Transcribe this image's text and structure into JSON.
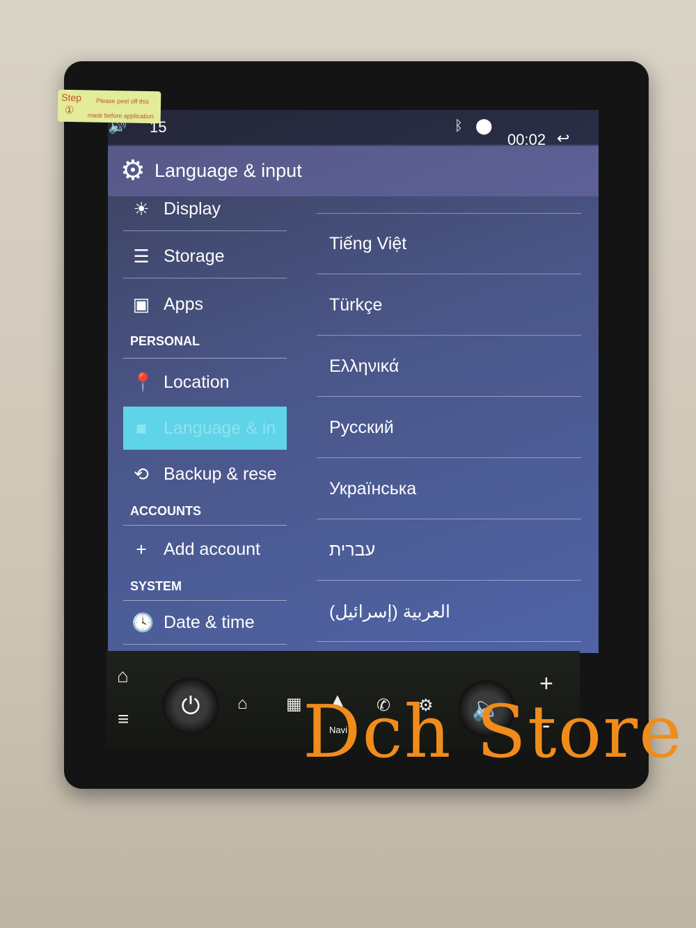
{
  "sticker": {
    "step": "Step",
    "num": "①",
    "line1": "Please peel off this",
    "line2": "mask before application"
  },
  "status": {
    "volume": "15",
    "time": "00:02",
    "icons": [
      "volume-icon",
      "bluetooth-icon",
      "location-icon",
      "back-icon"
    ]
  },
  "header": {
    "title": "Language & input"
  },
  "sidebar": {
    "items": [
      {
        "label": "Display",
        "icon": "brightness-icon"
      },
      {
        "label": "Storage",
        "icon": "storage-icon"
      },
      {
        "label": "Apps",
        "icon": "apps-icon"
      }
    ],
    "personal_header": "PERSONAL",
    "personal": [
      {
        "label": "Location",
        "icon": "location-icon"
      },
      {
        "label": "Language & in",
        "icon": "language-icon",
        "selected": true
      },
      {
        "label": "Backup & rese",
        "icon": "backup-icon"
      }
    ],
    "accounts_header": "ACCOUNTS",
    "accounts": [
      {
        "label": "Add account",
        "icon": "plus-icon"
      }
    ],
    "system_header": "SYSTEM",
    "system": [
      {
        "label": "Date & time",
        "icon": "clock-icon"
      }
    ]
  },
  "languages": [
    "Tiếng Việt",
    "Türkçe",
    "Ελληνικά",
    "Русский",
    "Українська",
    "עברית",
    "العربية (إسرائيل)"
  ],
  "dock": {
    "navi_label": "Navi",
    "plus": "+",
    "minus": "-"
  },
  "watermark": "Dch Store",
  "colors": {
    "selected": "#5fd3e8",
    "watermark": "#f08c1c"
  }
}
